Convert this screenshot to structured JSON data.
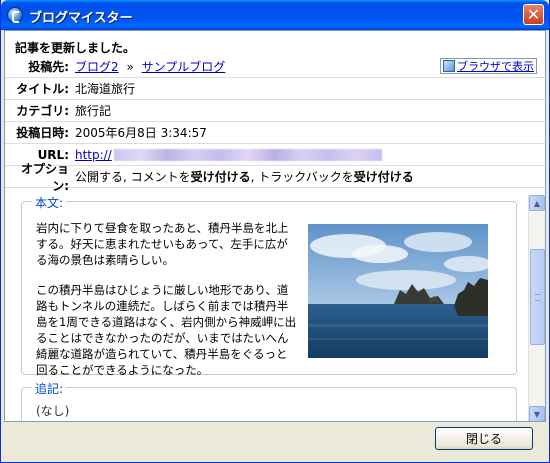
{
  "window": {
    "title": "ブログマイスター",
    "close_glyph": "✕"
  },
  "headline": "記事を更新しました。",
  "fields": {
    "post_to": {
      "label": "投稿先:",
      "blog": "ブログ2",
      "separator": "»",
      "category_blog": "サンプルブログ"
    },
    "title": {
      "label": "タイトル:",
      "value": "北海道旅行"
    },
    "category": {
      "label": "カテゴリ:",
      "value": "旅行記"
    },
    "datetime": {
      "label": "投稿日時:",
      "value": "2005年6月8日 3:34:57"
    },
    "url": {
      "label": "URL:",
      "value": "http://"
    },
    "options": {
      "label": "オプション:",
      "part1": "公開する",
      "sep1": ", コメントを",
      "accept1": "受け付ける",
      "sep2": ", トラックバックを",
      "accept2": "受け付ける"
    }
  },
  "preview_link": "ブラウザで表示",
  "body": {
    "label": "本文:",
    "paragraph1": "岩内に下りて昼食を取ったあと、積丹半島を北上する。好天に恵まれたせいもあって、左手に広がる海の景色は素晴らしい。",
    "paragraph2": "この積丹半島はひじょうに厳しい地形であり、道路もトンネルの連続だ。しばらく前までは積丹半島を1周できる道路はなく、岩内側から神威岬に出ることはできなかったのだが、いまではたいへん綺麗な道路が造られていて、積丹半島をぐるっと回ることができるようになった。"
  },
  "note": {
    "label": "追記:",
    "value": "(なし)"
  },
  "close_button": "閉じる",
  "icons": {
    "app": "blog-app-icon",
    "preview": "browser-icon"
  },
  "colors": {
    "titlebar": "#0054e3",
    "link": "#0000cc",
    "group_title": "#0046d5"
  }
}
